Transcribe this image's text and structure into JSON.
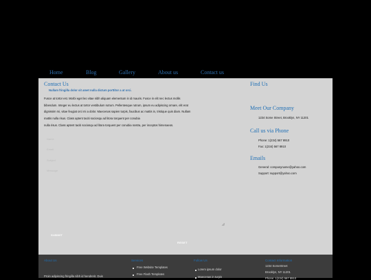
{
  "nav": {
    "items": [
      "Home",
      "Blog",
      "Gallery",
      "About us",
      "Contact us"
    ]
  },
  "contact": {
    "title": "Contact Us",
    "intro": "Nullam fringilla dolor sit amet nulla dictum porttitor a at orci.",
    "paragraph_lines": [
      "Fusce at tortor est. Morbi eget leo vitae nibh aliquam elementum in id mauris. Fusce in elit nec lectus mollis",
      "bibendum. Integer eu lectus at tortor vestibulum rutrum. Pellentesque rutrum, ipsum eu adipiscing ornare, elit erat",
      "dignissim mi, vitae feugiat orci mi a dolor. Maecenas sapien turpis, faucibus ac mattis in, tristique quis diam. Nullam",
      "mattis nulla risus. Class aptent taciti sociosqu ad litora torquent per conubia",
      "nulla risus. Class aptent taciti sociosqu ad litora torquent per conubia nostra, per inceptos himenaeos."
    ],
    "form": {
      "labels": [
        "Name",
        "Email",
        "Subject",
        "Message"
      ],
      "submit_label": "SUBMIT",
      "reset_label": "RESET"
    }
  },
  "sidebar": {
    "find_us": "Find Us",
    "meet_title": "Meet Our Company",
    "address": "1234 Some Street, Brooklyn, NY 11201",
    "call_title": "Call us via Phone",
    "phone": "Phone: 1(234) 567 8910",
    "fax": "Fax: 1(234) 567 8910",
    "emails_title": "Emails",
    "general": "General: companyname@yahoo.com",
    "support": "Support: support@yahoo.com"
  },
  "footer": {
    "about_title": "About Us",
    "about_text": "Proin adipiscing fringilla nibh id hendrerit. Duis",
    "services_title": "Services",
    "services": [
      "Free Website Templates",
      "Free Flash Templates"
    ],
    "follow_title": "Follow Us",
    "follow": [
      "Lorem ipsum dolor",
      "Maecenas in turpis"
    ],
    "contact_title": "Contact Information",
    "contact_lines": [
      "1234 SomeStreet",
      "Brooklyn, NY 11201",
      "Phone: 1(234) 567 8910"
    ]
  }
}
